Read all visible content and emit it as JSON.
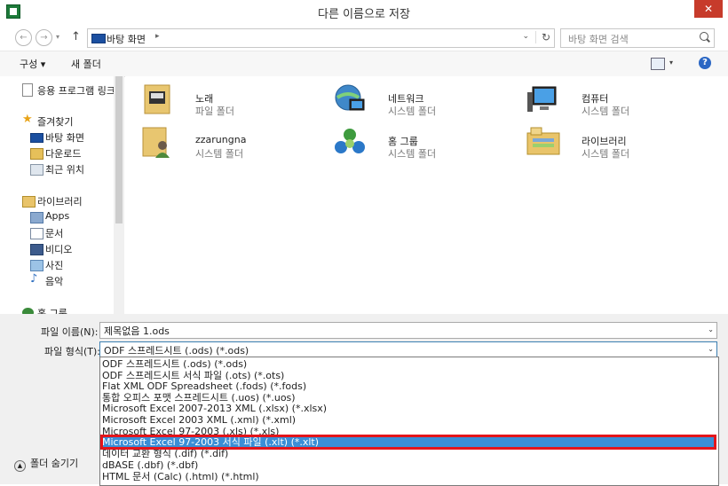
{
  "window": {
    "title": "다른 이름으로 저장",
    "close_glyph": "✕",
    "icon_name": "excel-app-icon"
  },
  "address": {
    "back_glyph": "←",
    "forward_glyph": "→",
    "dropdown_glyph": "▾",
    "up_glyph": "↑",
    "location": "바탕 화면",
    "sep_glyph": "▸",
    "addr_dropdown_glyph": "⌄",
    "refresh_glyph": "↻",
    "search_placeholder": "바탕 화면 검색"
  },
  "toolbar": {
    "organize": "구성 ▾",
    "new_folder": "새 폴더",
    "view_dd_glyph": "▾",
    "help_glyph": "?"
  },
  "sidebar": [
    {
      "label": "응용 프로그램 링크",
      "icon": "document-icon"
    },
    {
      "label": "즐겨찾기",
      "icon": "star-icon"
    },
    {
      "label": "바탕 화면",
      "icon": "desktop-icon"
    },
    {
      "label": "다운로드",
      "icon": "download-icon"
    },
    {
      "label": "최근 위치",
      "icon": "recent-places-icon"
    },
    {
      "label": "라이브러리",
      "icon": "library-icon"
    },
    {
      "label": "Apps",
      "icon": "apps-icon"
    },
    {
      "label": "문서",
      "icon": "documents-icon"
    },
    {
      "label": "비디오",
      "icon": "video-icon"
    },
    {
      "label": "사진",
      "icon": "pictures-icon"
    },
    {
      "label": "음악",
      "icon": "music-icon"
    },
    {
      "label": "홈 그룹",
      "icon": "homegroup-icon"
    }
  ],
  "items": [
    {
      "name": "노래",
      "type": "파일 폴더",
      "icon": "music-folder-icon"
    },
    {
      "name": "네트워크",
      "type": "시스템 폴더",
      "icon": "network-icon"
    },
    {
      "name": "컴퓨터",
      "type": "시스템 폴더",
      "icon": "computer-icon"
    },
    {
      "name": "zzarungna",
      "type": "시스템 폴더",
      "icon": "user-folder-icon"
    },
    {
      "name": "홈 그룹",
      "type": "시스템 폴더",
      "icon": "homegroup-icon"
    },
    {
      "name": "라이브러리",
      "type": "시스템 폴더",
      "icon": "library-icon"
    }
  ],
  "form": {
    "filename_label": "파일 이름(N):",
    "filename_value": "제목없음 1.ods",
    "filetype_label": "파일 형식(T):",
    "filetype_value": "ODF 스프레드시트 (.ods) (*.ods)",
    "dropdown_glyph": "⌄"
  },
  "filetype_options": [
    "ODF 스프레드시트 (.ods) (*.ods)",
    "ODF 스프레드시트 서식 파일 (.ots) (*.ots)",
    "Flat XML ODF Spreadsheet (.fods) (*.fods)",
    "통합 오피스 포맷 스프레드시트 (.uos) (*.uos)",
    "Microsoft Excel 2007-2013 XML (.xlsx) (*.xlsx)",
    "Microsoft Excel 2003 XML (.xml) (*.xml)",
    "Microsoft Excel 97-2003 (.xls) (*.xls)",
    "Microsoft Excel 97-2003 서식 파일 (.xlt) (*.xlt)",
    "데이터 교환 형식 (.dif) (*.dif)",
    "dBASE (.dbf) (*.dbf)",
    "HTML 문서 (Calc) (.html) (*.html)"
  ],
  "selected_option_index": 7,
  "hide_folders": {
    "label": "폴더 숨기기",
    "glyph": "▲"
  },
  "colors": {
    "selection": "#3a8ed6",
    "highlight_border": "#e3151b"
  }
}
